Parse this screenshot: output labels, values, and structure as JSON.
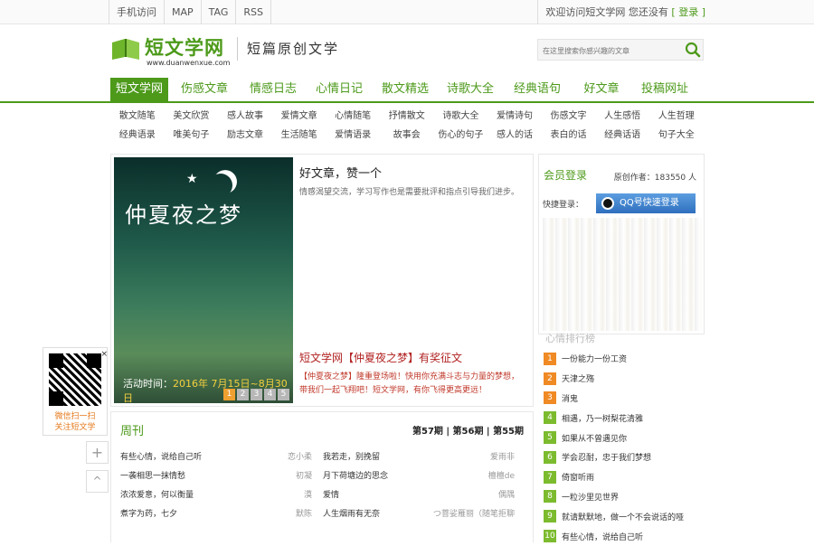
{
  "topbar": {
    "links": [
      "手机访问",
      "MAP",
      "TAG",
      "RSS"
    ],
    "welcome": "欢迎访问短文学网 您还没有",
    "login": "[ 登录 ]"
  },
  "header": {
    "logo_name": "短文学网",
    "logo_url": "www.duanwenxue.com",
    "slogan": "短篇原创文学",
    "search_placeholder": "在这里搜索你感兴趣的文章"
  },
  "nav": {
    "items": [
      {
        "label": "短文学网",
        "active": true
      },
      {
        "label": "伤感文章"
      },
      {
        "label": "情感日志"
      },
      {
        "label": "心情日记"
      },
      {
        "label": "散文精选"
      },
      {
        "label": "诗歌大全"
      },
      {
        "label": "经典语句"
      },
      {
        "label": "好文章"
      },
      {
        "label": "投稿网址"
      }
    ]
  },
  "subnav": {
    "row1": [
      "散文随笔",
      "美文欣赏",
      "感人故事",
      "爱情文章",
      "心情随笔",
      "抒情散文",
      "诗歌大全",
      "爱情诗句",
      "伤感文字",
      "人生感悟",
      "人生哲理"
    ],
    "row2": [
      "经典语录",
      "唯美句子",
      "励志文章",
      "生活随笔",
      "爱情语录",
      "故事会",
      "伤心的句子",
      "感人的话",
      "表白的话",
      "经典话语",
      "句子大全"
    ]
  },
  "feature": {
    "art_title": "仲夏夜之梦",
    "caption_prefix": "活动时间：",
    "caption_date": "2016年 7月15日~8月30日",
    "pages": [
      "1",
      "2",
      "3",
      "4",
      "5"
    ],
    "headline": "好文章，赞一个",
    "desc": "情感渴望交流，学习写作也是需要批评和指点引导我们进步。",
    "headline2": "短文学网【仲夏夜之梦】有奖征文",
    "desc2": "【仲夏夜之梦】隆重登场啦！快用你充满斗志与力量的梦想，带我们一起飞翔吧！短文学网，有你飞得更高更远！"
  },
  "weekly": {
    "title": "周刊",
    "issues": [
      "第57期",
      "第56期",
      "第55期"
    ],
    "issue_sep": " | ",
    "rows": [
      [
        {
          "title": "有些心情，说给自己听",
          "author": "恋小柔"
        },
        {
          "title": "我若走，别挽留",
          "author": "爱雨非"
        }
      ],
      [
        {
          "title": "一袭相思一抹情愁",
          "author": "初凝"
        },
        {
          "title": "月下荷塘边的思念",
          "author": "檀檀de"
        }
      ],
      [
        {
          "title": "浓浓爱意，何以衡量",
          "author": "漠"
        },
        {
          "title": "爱情",
          "author": "偶隅"
        }
      ],
      [
        {
          "title": "煮字为药，七夕",
          "author": "默陈"
        },
        {
          "title": "人生烟雨有无奈",
          "author": "つ菩娑雁丽（随笔拒聊"
        }
      ]
    ]
  },
  "member": {
    "title": "会员登录",
    "count": "原创作者：183550 人",
    "quick_label": "快捷登录：",
    "qq_label": "QQ号快速登录"
  },
  "ranks": {
    "title": "心情排行榜",
    "items": [
      {
        "label": "一份能力一份工资",
        "color": "#f08a24"
      },
      {
        "label": "天津之殇",
        "color": "#f08a24"
      },
      {
        "label": "消鬼",
        "color": "#f08a24"
      },
      {
        "label": "相遇，乃一树梨花清雅",
        "color": "#7cbb2e"
      },
      {
        "label": "如果从不曾遇见你",
        "color": "#7cbb2e"
      },
      {
        "label": "学会忍耐，忠于我们梦想",
        "color": "#7cbb2e"
      },
      {
        "label": "倚窗听雨",
        "color": "#7cbb2e"
      },
      {
        "label": "一粒沙里见世界",
        "color": "#7cbb2e"
      },
      {
        "label": "就请默默地，做一个不会说话的哑",
        "color": "#7cbb2e"
      },
      {
        "label": "有些心情，说给自己听",
        "color": "#7cbb2e"
      }
    ]
  },
  "qr": {
    "line1": "微信扫一扫",
    "line2": "关注短文学",
    "close": "×"
  },
  "side_buttons": {
    "plus": "+",
    "up": "^"
  },
  "colors": {
    "brand": "#4d9a1b",
    "accent": "#f08a24",
    "red": "#b22222"
  }
}
